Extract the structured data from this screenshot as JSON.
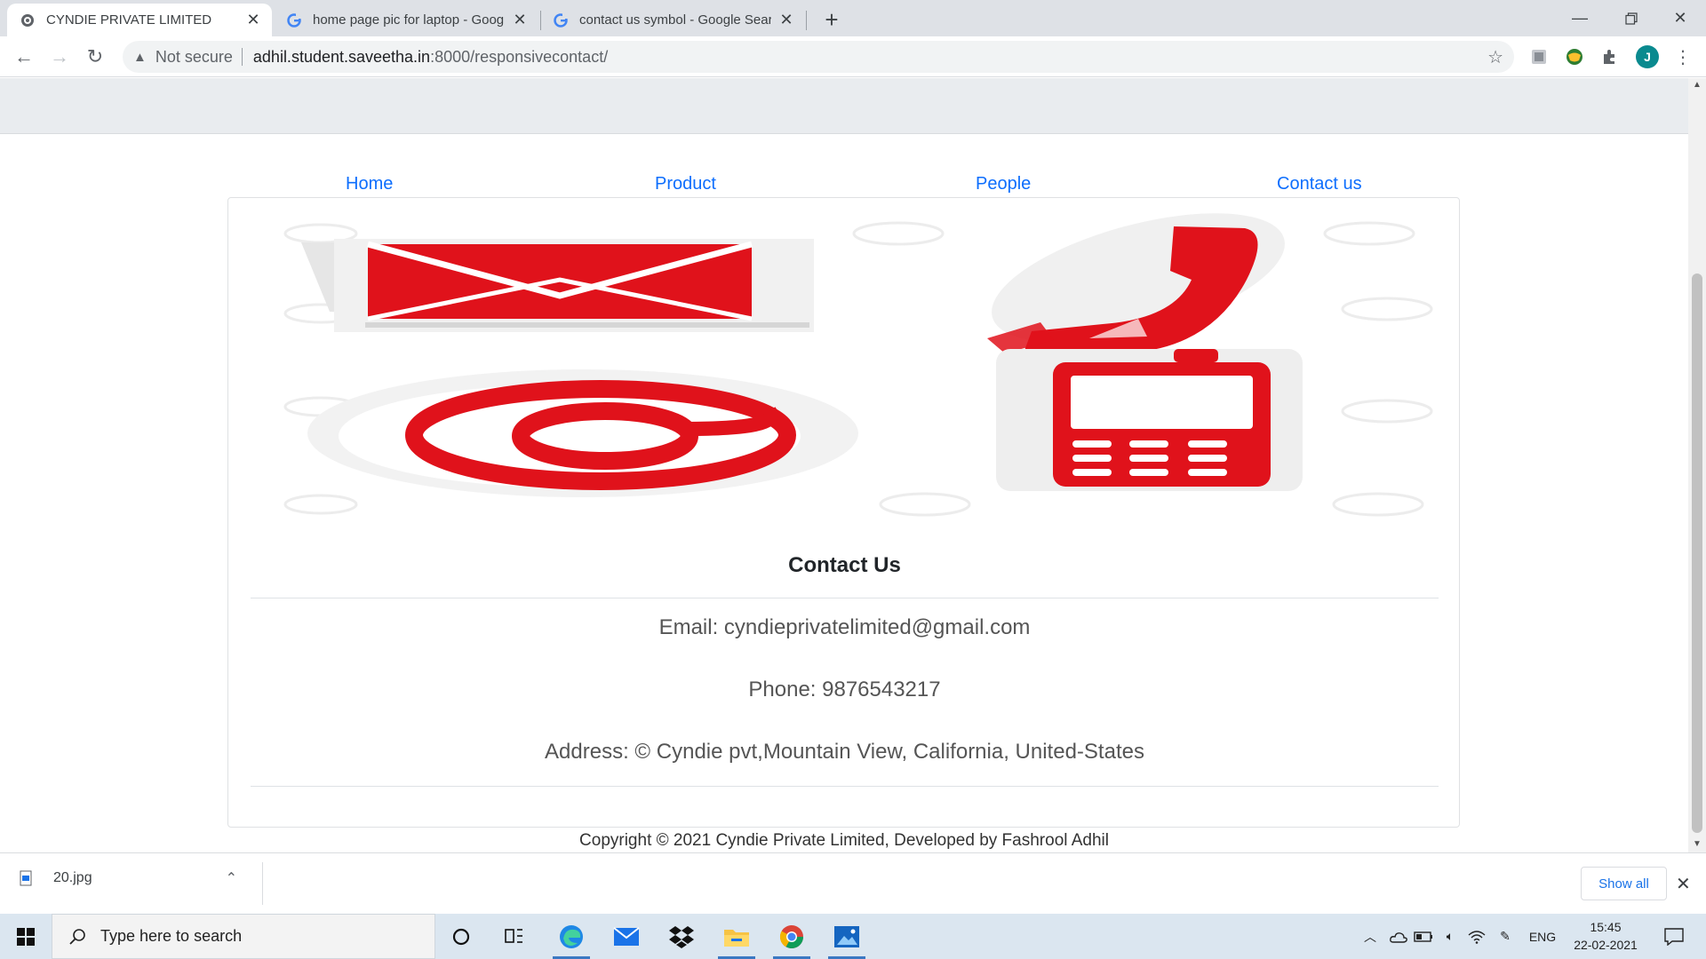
{
  "browser": {
    "tabs": [
      {
        "title": "CYNDIE PRIVATE LIMITED",
        "active": true
      },
      {
        "title": "home page pic for laptop - Goog",
        "active": false
      },
      {
        "title": "contact us symbol - Google Sear",
        "active": false
      }
    ],
    "url_security": "Not secure",
    "url_host": "adhil.student.saveetha.in",
    "url_path": ":8000/responsivecontact/",
    "profile_initial": "J"
  },
  "nav": {
    "items": [
      "Home",
      "Product",
      "People",
      "Contact us"
    ]
  },
  "contact": {
    "heading": "Contact Us",
    "email": "Email: cyndieprivatelimited@gmail.com",
    "phone": "Phone: 9876543217",
    "address": "Address: © Cyndie pvt,Mountain View, California, United-States"
  },
  "footer": {
    "copyright": "Copyright © 2021 Cyndie Private Limited, Developed by Fashrool Adhil"
  },
  "downloads": {
    "filename": "20.jpg",
    "show_all": "Show all"
  },
  "taskbar": {
    "search_placeholder": "Type here to search",
    "language": "ENG",
    "time": "15:45",
    "date": "22-02-2021"
  },
  "colors": {
    "accent_link": "#0d6efd",
    "icon_red": "#e0121b"
  }
}
